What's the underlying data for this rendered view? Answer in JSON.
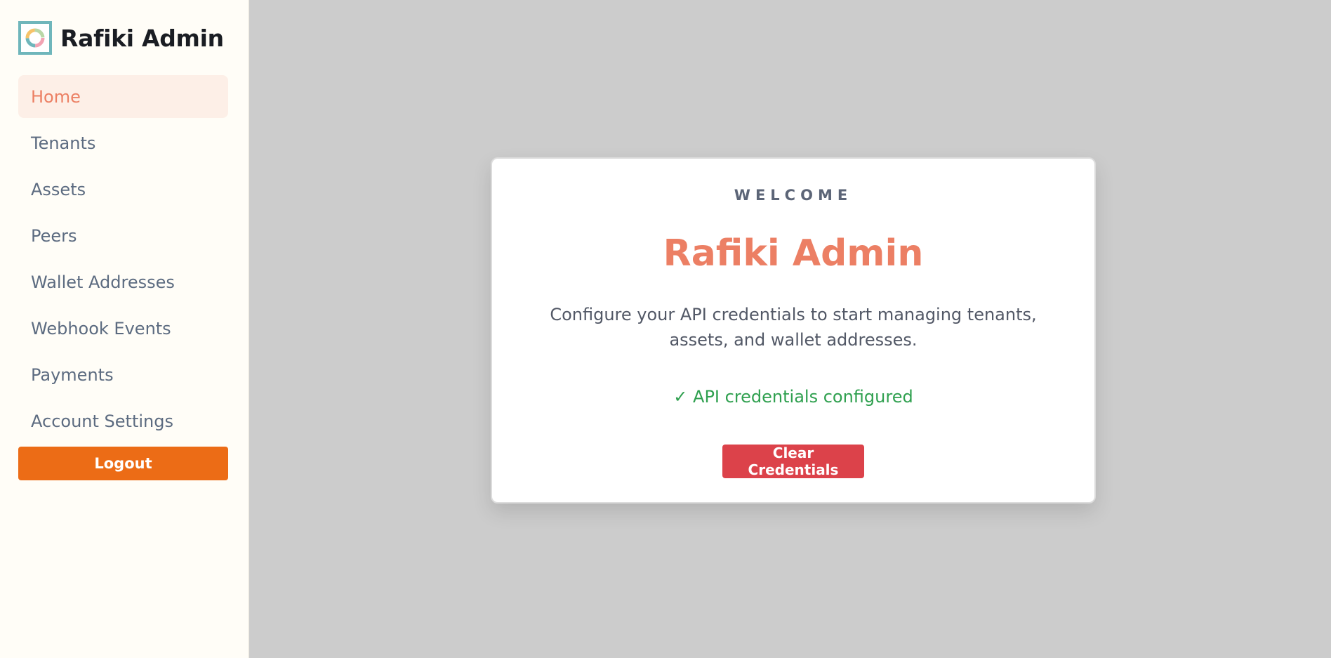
{
  "app": {
    "title": "Rafiki Admin",
    "logo_icon": "rafiki-ring-logo"
  },
  "sidebar": {
    "items": [
      {
        "label": "Home",
        "active": true
      },
      {
        "label": "Tenants",
        "active": false
      },
      {
        "label": "Assets",
        "active": false
      },
      {
        "label": "Peers",
        "active": false
      },
      {
        "label": "Wallet Addresses",
        "active": false
      },
      {
        "label": "Webhook Events",
        "active": false
      },
      {
        "label": "Payments",
        "active": false
      },
      {
        "label": "Account Settings",
        "active": false
      }
    ],
    "logout_label": "Logout"
  },
  "welcome": {
    "eyebrow": "WELCOME",
    "title": "Rafiki Admin",
    "description": "Configure your API credentials to start managing tenants, assets, and wallet addresses.",
    "status": "✓ API credentials configured",
    "clear_label": "Clear Credentials"
  },
  "colors": {
    "accent": "#ec7f64",
    "logout": "#ec6c16",
    "danger": "#dc424a",
    "success": "#2fa04f",
    "background": "#cccccc",
    "sidebar_bg": "#fffdf7"
  }
}
